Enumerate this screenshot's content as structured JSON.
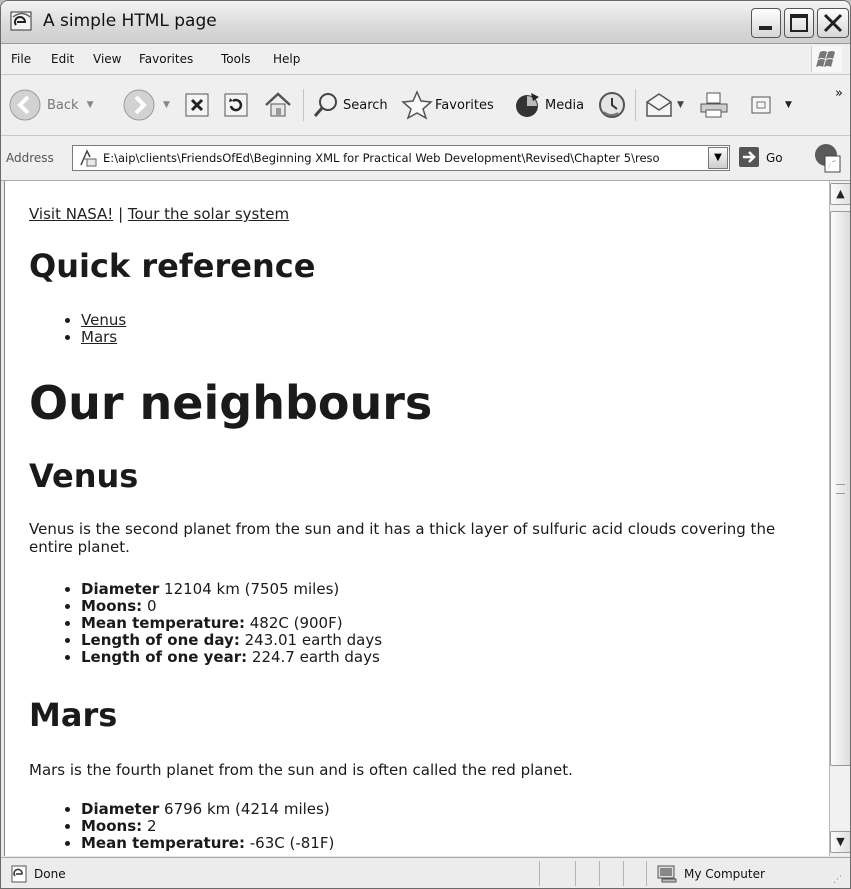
{
  "window": {
    "title": "A simple HTML page"
  },
  "menu": [
    "File",
    "Edit",
    "View",
    "Favorites",
    "Tools",
    "Help"
  ],
  "toolbar": {
    "back": "Back",
    "search": "Search",
    "favorites": "Favorites",
    "media": "Media",
    "overflow": "»"
  },
  "address": {
    "label": "Address",
    "url": "E:\\aip\\clients\\FriendsOfEd\\Beginning XML for Practical Web Development\\Revised\\Chapter 5\\reso",
    "go": "Go"
  },
  "page": {
    "links": {
      "nasa": "Visit NASA!",
      "separator": "|",
      "tour": "Tour the solar system"
    },
    "quick_heading": "Quick reference",
    "quick_items": [
      "Venus",
      "Mars"
    ],
    "main_heading": "Our neighbours",
    "venus": {
      "heading": "Venus",
      "description": "Venus is the second planet from the sun and it has a thick layer of sulfuric acid clouds covering the entire planet.",
      "facts": [
        {
          "label": "Diameter",
          "value": "12104 km (7505 miles)"
        },
        {
          "label": "Moons:",
          "value": "0"
        },
        {
          "label": "Mean temperature:",
          "value": "482C (900F)"
        },
        {
          "label": "Length of one day:",
          "value": "243.01 earth days"
        },
        {
          "label": "Length of one year:",
          "value": "224.7 earth days"
        }
      ]
    },
    "mars": {
      "heading": "Mars",
      "description": "Mars is the fourth planet from the sun and is often called the red planet.",
      "facts": [
        {
          "label": "Diameter",
          "value": "6796 km (4214 miles)"
        },
        {
          "label": "Moons:",
          "value": "2"
        },
        {
          "label": "Mean temperature:",
          "value": "-63C (-81F)"
        }
      ]
    }
  },
  "status": {
    "text": "Done",
    "zone": "My Computer"
  }
}
